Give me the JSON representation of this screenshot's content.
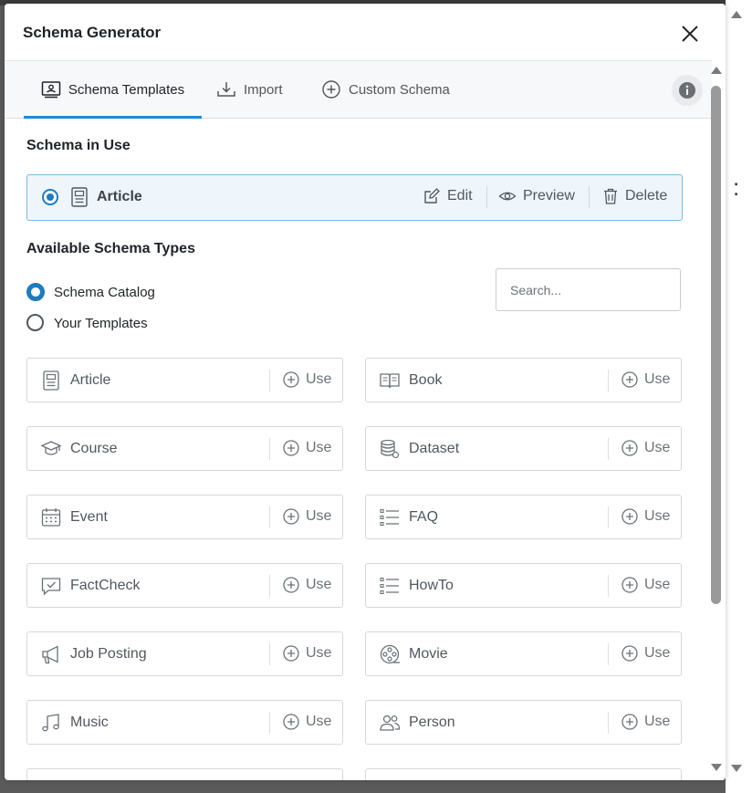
{
  "modal": {
    "title": "Schema Generator"
  },
  "tabs": [
    {
      "label": "Schema Templates",
      "icon": "template-icon",
      "active": true
    },
    {
      "label": "Import",
      "icon": "import-icon",
      "active": false
    },
    {
      "label": "Custom Schema",
      "icon": "plus-circle-icon",
      "active": false
    }
  ],
  "in_use": {
    "heading": "Schema in Use",
    "name": "Article",
    "edit": "Edit",
    "preview": "Preview",
    "delete": "Delete"
  },
  "available": {
    "heading": "Available Schema Types",
    "options": [
      "Schema Catalog",
      "Your Templates"
    ],
    "selected": "Schema Catalog",
    "search_placeholder": "Search..."
  },
  "use_label": "Use",
  "cards": [
    {
      "name": "Article",
      "icon": "article-icon"
    },
    {
      "name": "Book",
      "icon": "book-icon"
    },
    {
      "name": "Course",
      "icon": "course-icon"
    },
    {
      "name": "Dataset",
      "icon": "dataset-icon"
    },
    {
      "name": "Event",
      "icon": "calendar-icon"
    },
    {
      "name": "FAQ",
      "icon": "list-icon"
    },
    {
      "name": "FactCheck",
      "icon": "factcheck-icon"
    },
    {
      "name": "HowTo",
      "icon": "list-icon"
    },
    {
      "name": "Job Posting",
      "icon": "megaphone-icon"
    },
    {
      "name": "Movie",
      "icon": "film-reel-icon"
    },
    {
      "name": "Music",
      "icon": "music-note-icon"
    },
    {
      "name": "Person",
      "icon": "person-icon"
    }
  ],
  "colors": {
    "accent": "#1d8ad0",
    "radio": "#1d7cc0",
    "in_use_bg": "#eef6fb",
    "in_use_border": "#7db8dc"
  }
}
